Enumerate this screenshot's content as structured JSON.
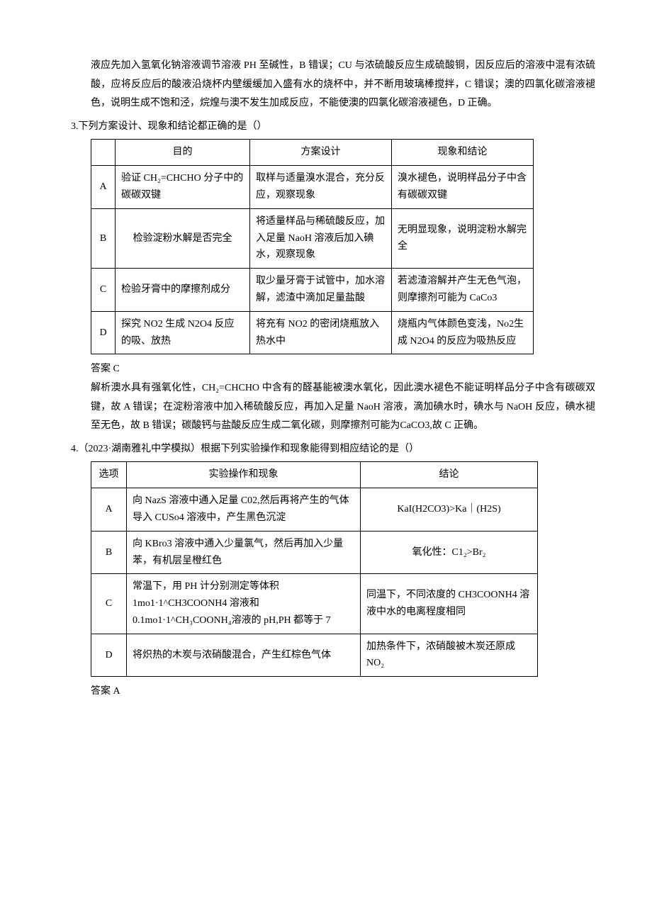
{
  "intro_paragraph": "液应先加入氢氧化钠溶液调节溶液 PH 至碱性，B 错误；CU 与浓硫酸反应生成硫酸铜，因反应后的溶液中混有浓硫酸，应将反应后的酸液沿烧杯内壁缓缓加入盛有水的烧杯中，并不断用玻璃棒搅拌，C 错误；澳的四氯化碳溶液褪色，说明生成不饱和泾，烷煌与澳不发生加成反应，不能使澳的四氯化碳溶液褪色，D 正确。",
  "q3": {
    "stem": "3.下列方案设计、现象和结论都正确的是（）",
    "headers": [
      "",
      "目的",
      "方案设计",
      "现象和结论"
    ],
    "rows": [
      {
        "opt": "A",
        "purpose": "验证 CH₂=CHCHO 分子中的碳碳双键",
        "plan": "取样与适量溴水混合，充分反应，观察现象",
        "result": "溴水褪色，说明样品分子中含有碳碳双键"
      },
      {
        "opt": "B",
        "purpose": "检验淀粉水解是否完全",
        "plan": "将适量样品与稀硫酸反应，加入足量 NaoH 溶液后加入碘水，观察现象",
        "result": "无明显现象，说明淀粉水解完全"
      },
      {
        "opt": "C",
        "purpose": "检验牙膏中的摩擦剂成分",
        "plan": "取少量牙膏于试管中，加水溶解，滤渣中滴加足量盐酸",
        "result": "若滤渣溶解并产生无色气泡，则摩擦剂可能为 CaCo3"
      },
      {
        "opt": "D",
        "purpose": "探究 NO2 生成 N2O4 反应的吸、放热",
        "plan": "将充有 NO2 的密闭烧瓶放入热水中",
        "result": "烧瓶内气体颜色变浅，No2生成 N2O4 的反应为吸热反应"
      }
    ],
    "answer_label": "答案 C",
    "explain": "解析澳水具有强氧化性，CH₂=CHCHO 中含有的醛基能被澳水氧化，因此澳水褪色不能证明样品分子中含有碳碳双键，故 A 错误；在淀粉溶液中加入稀硫酸反应，再加入足量 NaoH 溶液，滴加碘水时，碘水与 NaOH 反应，碘水褪至无色，故 B 错误；碳酸钙与盐酸反应生成二氧化碳，则摩擦剂可能为CaCO3,故 C 正确。"
  },
  "q4": {
    "stem": "4.（2023·湖南雅礼中学模拟）根据下列实验操作和现象能得到相应结论的是（）",
    "headers": [
      "选项",
      "实验操作和现象",
      "结论"
    ],
    "rows": [
      {
        "opt": "A",
        "op": "向 NazS 溶液中通入足量 C02,然后再将产生的气体导入 CUSo4 溶液中，产生黑色沉淀",
        "concl": "KaI(H2CO3)>Ka｜(H2S)"
      },
      {
        "opt": "B",
        "op": "向 KBro3 溶液中通入少量氯气，然后再加入少量苯，有机层呈橙红色",
        "concl": "氧化性：C1₂>Br₂"
      },
      {
        "opt": "C",
        "op": "常温下，用 PH 计分别测定等体积1mo1·1^CH3COONH4 溶液和0.1mo1·1^CH₃COONH₄溶液的 pH,PH 都等于 7",
        "concl": "同温下，不同浓度的 CH3COONH4 溶液中水的电离程度相同"
      },
      {
        "opt": "D",
        "op": "将炽热的木炭与浓硝酸混合，产生红棕色气体",
        "concl": "加热条件下，浓硝酸被木炭还原成NO₂"
      }
    ],
    "answer_label": "答案 A"
  }
}
